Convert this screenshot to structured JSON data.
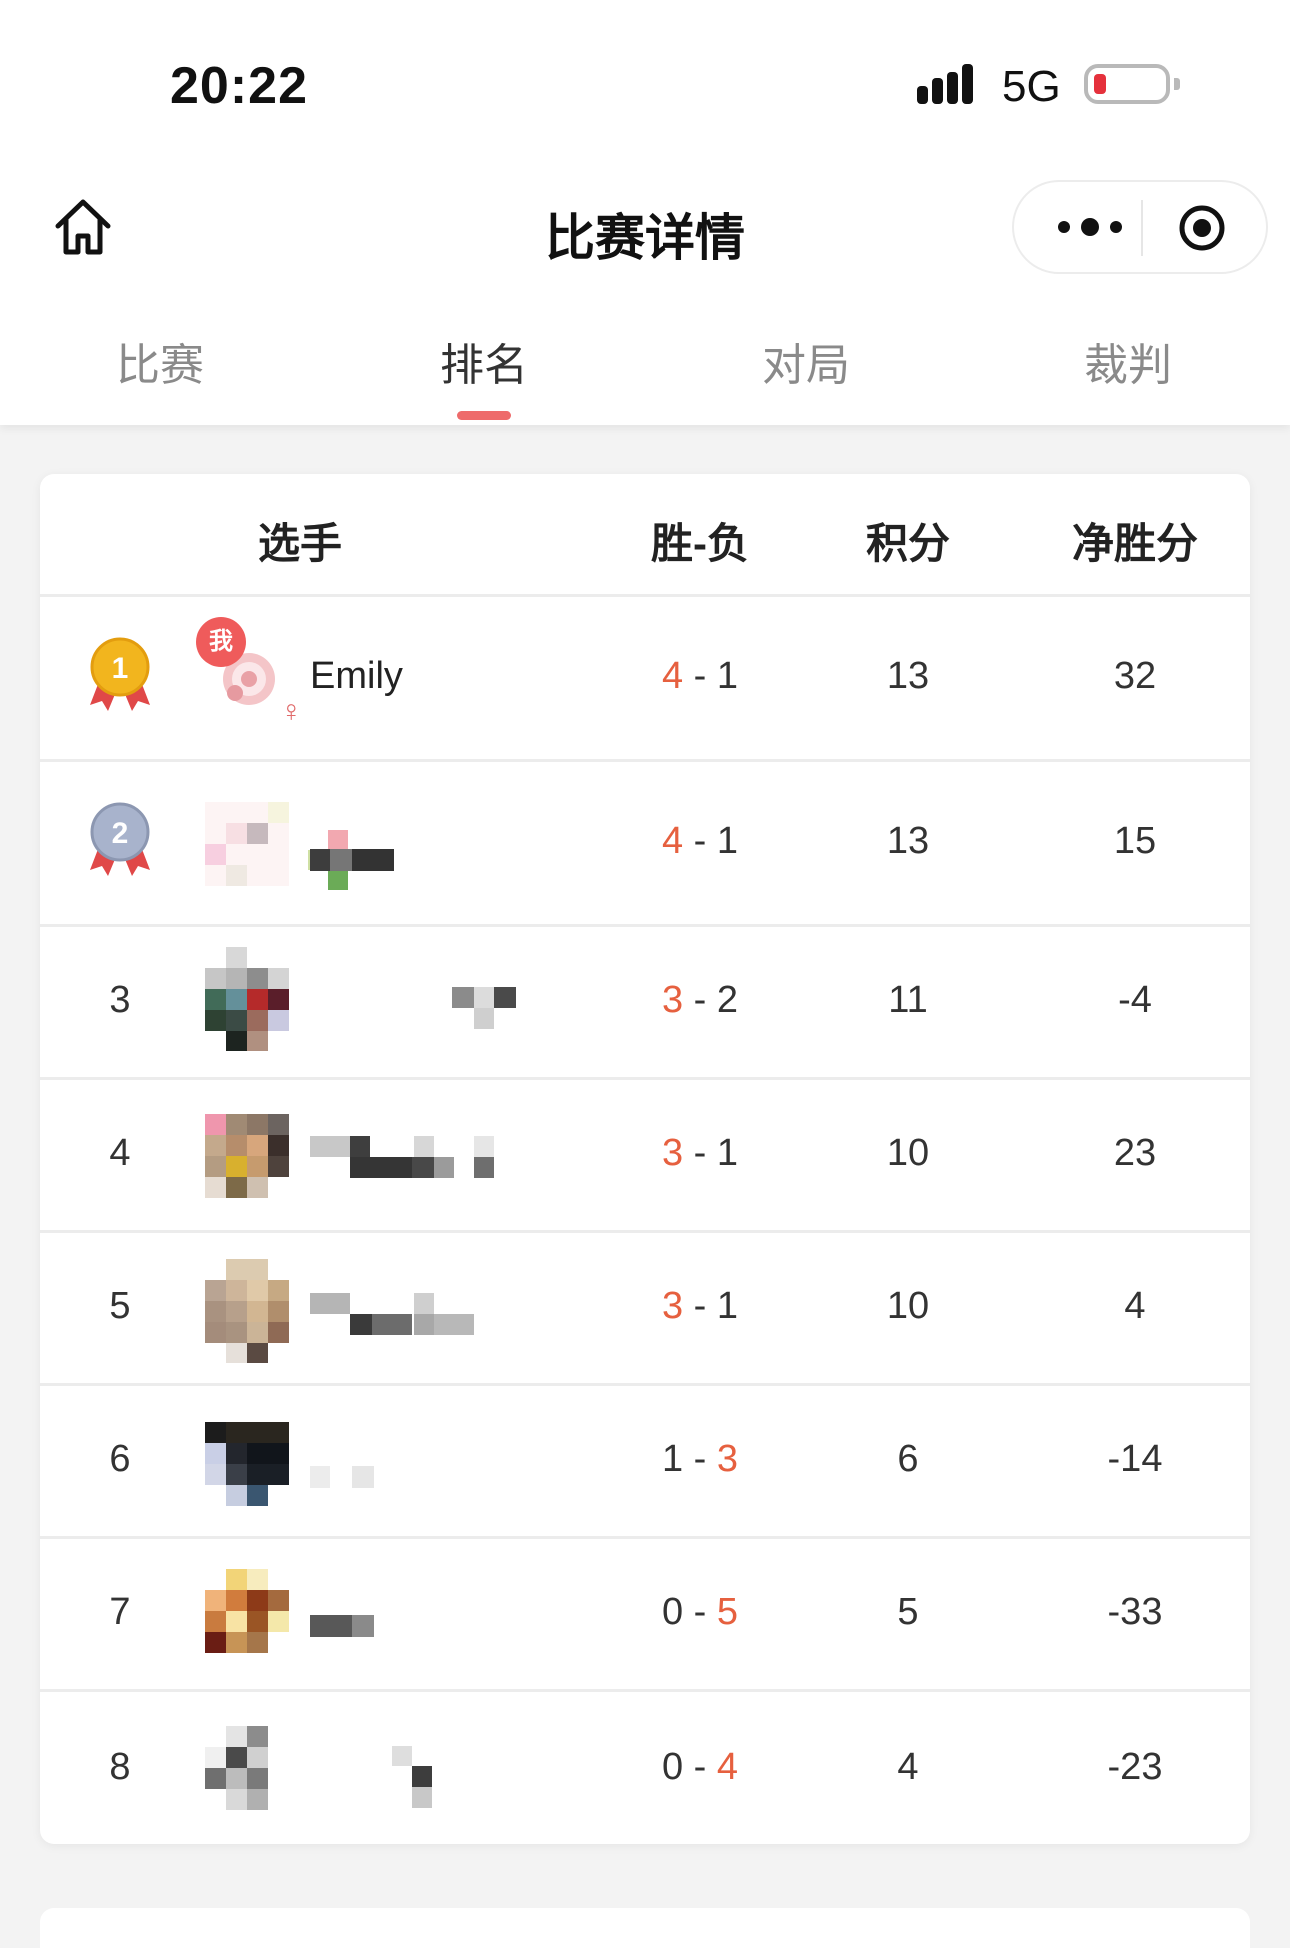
{
  "status_bar": {
    "time": "20:22",
    "network": "5G",
    "battery_level": 0.1
  },
  "nav": {
    "title": "比赛详情",
    "home_icon": "home-icon",
    "more_icon": "more-icon",
    "close_icon": "target-icon"
  },
  "tabs": [
    {
      "label": "比赛",
      "active": false
    },
    {
      "label": "排名",
      "active": true
    },
    {
      "label": "对局",
      "active": false
    },
    {
      "label": "裁判",
      "active": false
    }
  ],
  "table": {
    "headers": {
      "player": "选手",
      "wl": "胜-负",
      "points": "积分",
      "net": "净胜分"
    },
    "rows": [
      {
        "rank": "1",
        "medal": "gold",
        "name": "Emily",
        "me_badge": "我",
        "gender": "♀",
        "wins": "4",
        "losses": "1",
        "points": "13",
        "net": "32"
      },
      {
        "rank": "2",
        "medal": "silver",
        "name": "",
        "wins": "4",
        "losses": "1",
        "points": "13",
        "net": "15"
      },
      {
        "rank": "3",
        "name": "",
        "wins": "3",
        "losses": "2",
        "points": "11",
        "net": "-4"
      },
      {
        "rank": "4",
        "name": "",
        "wins": "3",
        "losses": "1",
        "points": "10",
        "net": "23"
      },
      {
        "rank": "5",
        "name": "",
        "wins": "3",
        "losses": "1",
        "points": "10",
        "net": "4"
      },
      {
        "rank": "6",
        "name": "",
        "wins": "1",
        "losses": "3",
        "points": "6",
        "net": "-14"
      },
      {
        "rank": "7",
        "name": "",
        "wins": "0",
        "losses": "5",
        "points": "5",
        "net": "-33"
      },
      {
        "rank": "8",
        "name": "",
        "wins": "0",
        "losses": "4",
        "points": "4",
        "net": "-23"
      }
    ]
  },
  "colors": {
    "accent": "#ee6b6b",
    "win_highlight": "#e6603f",
    "gold": "#f2b51e",
    "silver": "#a8b3cc",
    "ribbon": "#e04848"
  }
}
